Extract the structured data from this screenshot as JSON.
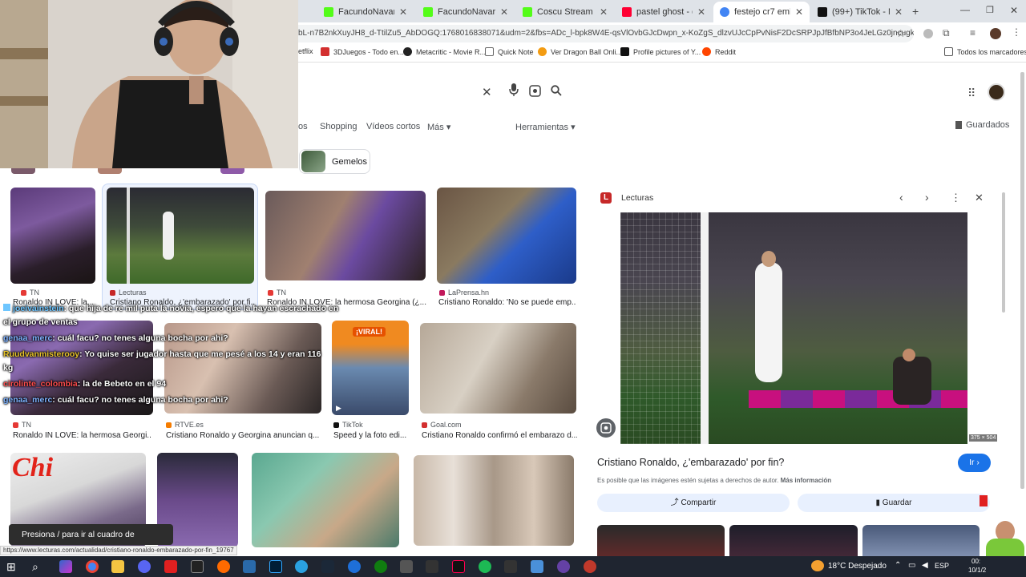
{
  "browser": {
    "tabs": [
      {
        "label": "FacundoNavarrete St",
        "color": "#53fc18"
      },
      {
        "label": "FacundoNavarrete St",
        "color": "#53fc18"
      },
      {
        "label": "Coscu Stream - Watc",
        "color": "#53fc18"
      },
      {
        "label": "pastel ghost - dark b",
        "color": "#ff0033"
      },
      {
        "label": "festejo cr7 embaraz",
        "color": "#4285f4"
      },
      {
        "label": "(99+) TikTok - Make Y",
        "color": "#111111"
      }
    ],
    "new_tab": "+",
    "url": "bL-n7B2nkXuyJH8_d-TtilZu5_AbDOGQ:1768016838071&udm=2&fbs=ADc_l-bpk8W4E-qsVlOvbGJcDwpn_x-KoZgS_dlzvUJcCpPvNisF2DcSRPJpJfBfbNP3o4JeLGz0jncugk5V_VFRDv...",
    "bookmarks": [
      {
        "label": "etflix",
        "color": "#e50914"
      },
      {
        "label": "3DJuegos - Todo en...",
        "color": "#d32f2f"
      },
      {
        "label": "Metacritic - Movie R...",
        "color": "#222222"
      },
      {
        "label": "Quick Note",
        "color": "#666666"
      },
      {
        "label": "Ver Dragon Ball Onli...",
        "color": "#f39c12"
      },
      {
        "label": "Profile pictures of Y...",
        "color": "#111111"
      },
      {
        "label": "Reddit",
        "color": "#ff4500"
      }
    ],
    "all_bookmarks": "Todos los marcadores"
  },
  "search": {
    "filters": [
      "os",
      "Shopping",
      "Vídeos cortos",
      "Más ▾",
      "Herramientas ▾"
    ],
    "saved": "Guardados",
    "chip": "Gemelos"
  },
  "results": [
    {
      "source": "TN",
      "caption": "Ronaldo IN LOVE: la...",
      "src_color": "#e53935"
    },
    {
      "source": "Lecturas",
      "caption": "Cristiano Ronaldo, ¿'embarazado' por fi...",
      "src_color": "#c62828"
    },
    {
      "source": "TN",
      "caption": "Ronaldo IN LOVE: la hermosa Georgina (¿...",
      "src_color": "#e53935"
    },
    {
      "source": "LaPrensa.hn",
      "caption": "Cristiano Ronaldo: 'No se puede emp...",
      "src_color": "#c2185b"
    },
    {
      "source": "TN",
      "caption": "Ronaldo IN LOVE: la hermosa Georgi...",
      "src_color": "#e53935"
    },
    {
      "source": "RTVE.es",
      "caption": "Cristiano Ronaldo y Georgina anuncian q...",
      "src_color": "#f57c00"
    },
    {
      "source": "TikTok",
      "caption": "Speed y la foto edi...",
      "src_color": "#111111"
    },
    {
      "source": "Goal.com",
      "caption": "Cristiano Ronaldo confirmó el embarazo d...",
      "src_color": "#d32f2f"
    }
  ],
  "thumb_badges": {
    "viral": "¡VIRAL!",
    "magazine": "Chi"
  },
  "chat": [
    {
      "user": "joeivainstein",
      "text": ": que hija de re mil puta la novia, espero que la hayan escrachado en",
      "user_color": "#6ec6ff"
    },
    {
      "user": "",
      "text": "el grupo de ventas",
      "user_color": "#ffffff"
    },
    {
      "user": "genaa_merc",
      "text": ": cuál facu? no tenes alguna bocha por ahi?",
      "user_color": "#7fb3ff"
    },
    {
      "user": "Ruudvanmisterooy",
      "text": ": Yo quise ser jugador hasta que me pesé a los 14 y eran 116",
      "user_color": "#e6c229"
    },
    {
      "user": "",
      "text": "kg",
      "user_color": "#ffffff"
    },
    {
      "user": "cirolinte_colombia",
      "text": ": la de Bebeto en el 94",
      "user_color": "#ff4d4d"
    },
    {
      "user": "genaa_merc",
      "text": ": cuál facu? no tenes alguna bocha por ahi?",
      "user_color": "#7fb3ff"
    }
  ],
  "panel": {
    "source": "Lecturas",
    "title": "Cristiano Ronaldo, ¿'embarazado' por fin?",
    "visit": "Ir",
    "copyright": "Es posible que las imágenes estén sujetas a derechos de autor.",
    "more_info": "Más información",
    "share": "Compartir",
    "save": "Guardar",
    "dimensions": "375 × 504"
  },
  "toast": "Presiona / para ir al cuadro de búsqueda",
  "status_url": "https://www.lecturas.com/actualidad/cristiano-ronaldo-embarazado-por-fin_19767",
  "taskbar": {
    "weather": "18°C  Despejado",
    "lang": "ESP",
    "time": "00:",
    "date": "10/1/2"
  }
}
